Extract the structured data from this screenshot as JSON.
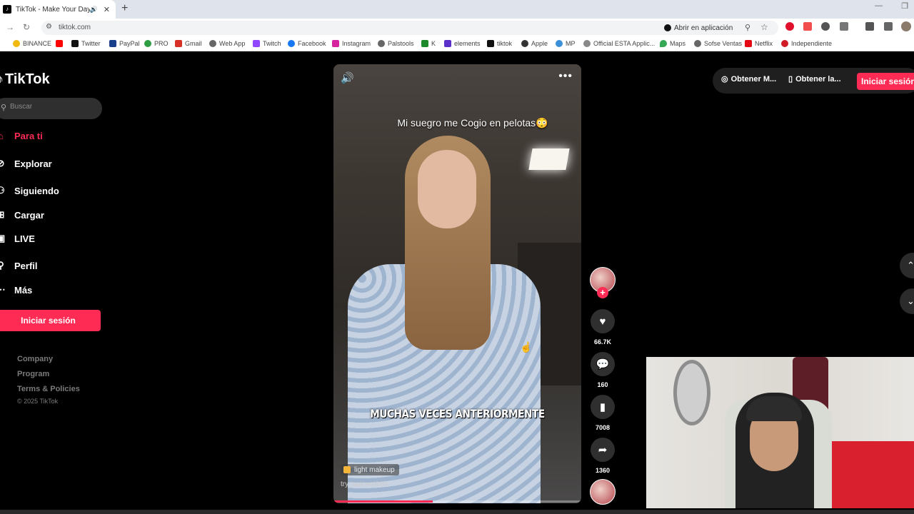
{
  "browser": {
    "tab_title": "TikTok - Make Your Day",
    "url": "tiktok.com",
    "open_in_app": "Abrir en aplicación",
    "bookmarks": [
      "BINANCE",
      "Twitter",
      "PayPal",
      "PRO",
      "Gmail",
      "Web App",
      "Twitch",
      "Facebook",
      "Instagram",
      "Palstools",
      "K",
      "elements",
      "tiktok",
      "Apple",
      "MP",
      "Official ESTA Applic...",
      "Maps",
      "Sofse Ventas",
      "Netflix",
      "Independiente"
    ]
  },
  "sidebar": {
    "logo": "TikTok",
    "search_placeholder": "Buscar",
    "items": [
      {
        "label": "Para ti",
        "icon": "home-icon"
      },
      {
        "label": "Explorar",
        "icon": "compass-icon"
      },
      {
        "label": "Siguiendo",
        "icon": "following-icon"
      },
      {
        "label": "Cargar",
        "icon": "upload-icon"
      },
      {
        "label": "LIVE",
        "icon": "live-icon"
      },
      {
        "label": "Perfil",
        "icon": "profile-icon"
      },
      {
        "label": "Más",
        "icon": "more-icon"
      }
    ],
    "login": "Iniciar sesión",
    "footer": [
      "Company",
      "Program",
      "Terms & Policies"
    ],
    "copyright": "© 2025 TikTok"
  },
  "video": {
    "caption_top": "Mi suegro me Cogio en pelotas😳",
    "caption_bottom": "MUCHAS VECES ANTERIORMENTE",
    "tag": "light makeup",
    "author": "try_spicycubes",
    "progress": 0.4
  },
  "actions": {
    "likes": "66.7K",
    "comments": "160",
    "saves": "7008",
    "shares": "1360"
  },
  "topbar": {
    "get_coins": "Obtener M...",
    "get_app": "Obtener la...",
    "login": "Iniciar sesión"
  }
}
